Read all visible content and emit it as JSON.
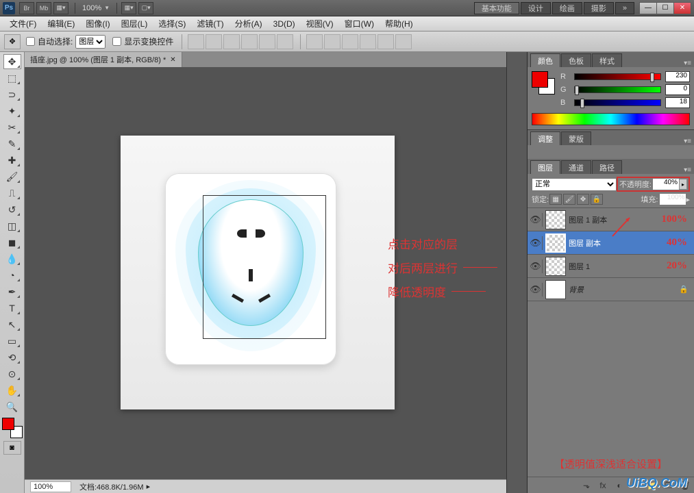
{
  "titlebar": {
    "ps": "Ps",
    "btns": [
      "Br",
      "Mb"
    ],
    "zoom": "100%",
    "workspaces": [
      "基本功能",
      "设计",
      "绘画",
      "摄影"
    ],
    "expand": "»"
  },
  "menubar": [
    "文件(F)",
    "编辑(E)",
    "图像(I)",
    "图层(L)",
    "选择(S)",
    "滤镜(T)",
    "分析(A)",
    "3D(D)",
    "视图(V)",
    "窗口(W)",
    "帮助(H)"
  ],
  "optbar": {
    "auto_select": "自动选择:",
    "target": "图层",
    "show_transform": "显示变换控件"
  },
  "doc_tab": {
    "title": "插座.jpg @ 100% (图层 1 副本, RGB/8) *"
  },
  "status": {
    "zoom": "100%",
    "info": "文档:468.8K/1.96M"
  },
  "color_panel": {
    "tabs": [
      "颜色",
      "色板",
      "样式"
    ],
    "r": "230",
    "g": "0",
    "b": "18"
  },
  "adjust_panel": {
    "tabs": [
      "调整",
      "蒙版"
    ]
  },
  "layers_panel": {
    "tabs": [
      "图层",
      "通道",
      "路径"
    ],
    "blend": "正常",
    "opacity_label": "不透明度:",
    "opacity_value": "40%",
    "lock_label": "锁定:",
    "fill_label": "填充:",
    "fill_value": "100%",
    "layers": [
      {
        "name": "图层 1 副本",
        "pct": "100%",
        "selected": false
      },
      {
        "name": "图层  副本",
        "pct": "40%",
        "selected": true
      },
      {
        "name": "图层 1",
        "pct": "20%",
        "selected": false
      },
      {
        "name": "背景",
        "pct": "",
        "selected": false,
        "locked": true,
        "bg": true
      }
    ]
  },
  "annotations": {
    "l1": "点击对应的层",
    "l2": "对后两层进行",
    "l3": "降低透明度",
    "note": "【透明值深浅适合设置】"
  },
  "watermark": "UiBQ.CoM"
}
